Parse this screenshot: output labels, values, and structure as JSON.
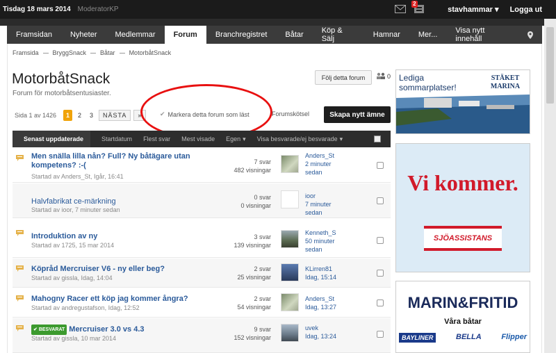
{
  "topbar": {
    "date": "Tisdag 18 mars 2014",
    "role": "ModeratorKP",
    "notification_count": "2",
    "username": "stavhammar",
    "logout": "Logga ut"
  },
  "nav": {
    "items": [
      "Framsidan",
      "Nyheter",
      "Medlemmar",
      "Forum",
      "Branchregistret",
      "Båtar",
      "Köp & Sälj",
      "Hamnar",
      "Mer..."
    ],
    "active": "Forum",
    "view_new": "Visa nytt innehåll"
  },
  "breadcrumb": [
    "Framsida",
    "BryggSnack",
    "Båtar",
    "MotorbåtSnack"
  ],
  "forum": {
    "title": "MotorbåtSnack",
    "subtitle": "Forum för motorbåtsentusiaster.",
    "follow_label": "Följ detta forum",
    "followers": "0"
  },
  "pager": {
    "label": "Sida 1 av 1426",
    "pages": [
      "1",
      "2",
      "3"
    ],
    "next": "NÄSTA",
    "last": "»"
  },
  "actions": {
    "mark_read": "Markera detta forum som läst",
    "tools": "Forumskötsel",
    "new_topic": "Skapa nytt ämne"
  },
  "table_header": {
    "sort_active": "Senast uppdaterade",
    "cols": [
      "Startdatum",
      "Flest svar",
      "Mest visade",
      "Egen",
      "Visa besvarade/ej besvarade"
    ]
  },
  "topics": [
    {
      "title": "Men snälla lilla nån? Full? Ny båtägare utan kompetens? :-(",
      "started": "Startad av Anders_St, Igår, 16:41",
      "replies": "7 svar",
      "views": "482 visningar",
      "last_user": "Anders_St",
      "last_time1": "2 minuter",
      "last_time2": "sedan",
      "bold": true,
      "solved": false
    },
    {
      "title": "Halvfabrikat ce-märkning",
      "started": "Startad av ioor, 7 minuter sedan",
      "replies": "0 svar",
      "views": "0 visningar",
      "last_user": "ioor",
      "last_time1": "7 minuter",
      "last_time2": "sedan",
      "bold": false,
      "solved": false
    },
    {
      "title": "Introduktion av ny",
      "started": "Startad av 1725, 15 mar 2014",
      "replies": "3 svar",
      "views": "139 visningar",
      "last_user": "Kenneth_S",
      "last_time1": "50 minuter",
      "last_time2": "sedan",
      "bold": true,
      "solved": false
    },
    {
      "title": "Köpråd Mercruiser V6 - ny eller beg?",
      "started": "Startad av gissla, Idag, 14:04",
      "replies": "2 svar",
      "views": "25 visningar",
      "last_user": "KLirren81",
      "last_time1": "Idag, 15:14",
      "last_time2": "",
      "bold": true,
      "solved": false
    },
    {
      "title": "Mahogny Racer ett köp jag kommer ångra?",
      "started": "Startad av andregustafson, Idag, 12:52",
      "replies": "2 svar",
      "views": "54 visningar",
      "last_user": "Anders_St",
      "last_time1": "Idag, 13:27",
      "last_time2": "",
      "bold": true,
      "solved": false
    },
    {
      "title": "Mercruiser 3.0 vs 4.3",
      "started": "Startad av gissla, 10 mar 2014",
      "replies": "9 svar",
      "views": "152 visningar",
      "last_user": "uvek",
      "last_time1": "Idag, 13:24",
      "last_time2": "",
      "bold": true,
      "solved": true,
      "solved_label": "BESVARAT"
    }
  ],
  "ads": {
    "ad1_text": "Lediga sommarplatser!",
    "ad1_brand": "STÄKET MARINA",
    "ad2_headline": "Vi kommer.",
    "ad2_brand": "SJÖASSISTANS",
    "ad3_brand": "MARIN&FRITID",
    "ad3_sub": "Våra båtar",
    "ad3_logos": [
      "BAYLINER",
      "BELLA",
      "Flipper"
    ]
  },
  "colors": {
    "accent_orange": "#f0a30a",
    "link_blue": "#2a5a9a",
    "highlight_red": "#e81010",
    "solved_green": "#3c9a2e"
  }
}
